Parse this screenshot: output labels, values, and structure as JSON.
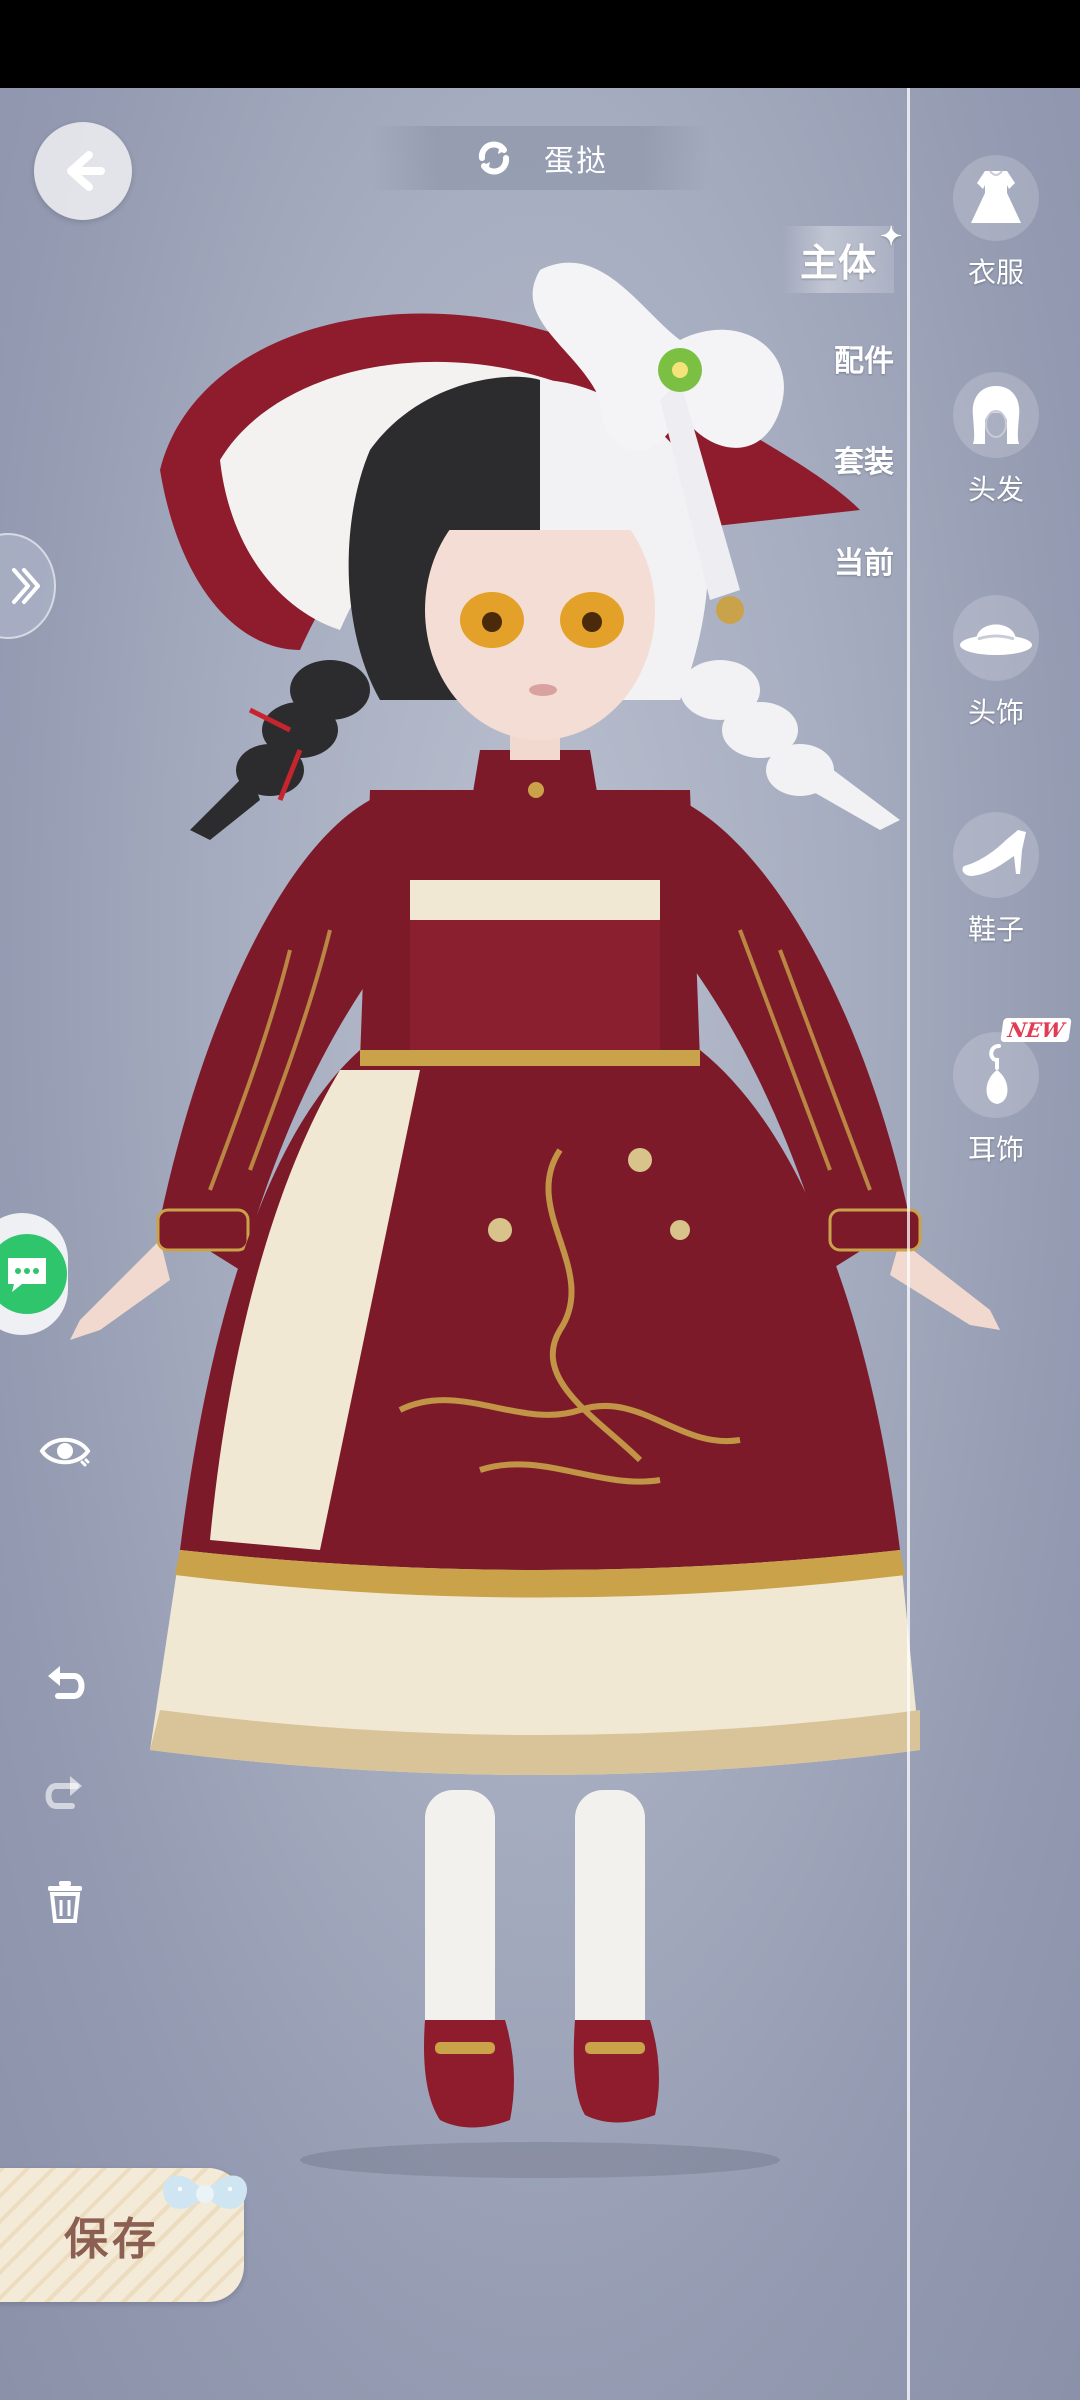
{
  "header": {
    "title": "蛋挞"
  },
  "category_tabs": [
    {
      "label": "主体",
      "active": true
    },
    {
      "label": "配件",
      "active": false
    },
    {
      "label": "套装",
      "active": false
    },
    {
      "label": "当前",
      "active": false
    }
  ],
  "side_menu": [
    {
      "label": "衣服",
      "icon": "dress-icon"
    },
    {
      "label": "头发",
      "icon": "hair-icon"
    },
    {
      "label": "头饰",
      "icon": "hat-icon"
    },
    {
      "label": "鞋子",
      "icon": "shoe-icon"
    },
    {
      "label": "耳饰",
      "icon": "earring-icon",
      "badge": "NEW"
    }
  ],
  "tools": {
    "view": "eye-icon",
    "undo": "undo-icon",
    "redo": "redo-icon",
    "delete": "trash-icon"
  },
  "save_label": "保存",
  "colors": {
    "dress": "#7d1a2a",
    "gold": "#c9a24a",
    "cream": "#f0e8d2",
    "chat_green": "#2fc56d",
    "save_text": "#8b5f52"
  }
}
